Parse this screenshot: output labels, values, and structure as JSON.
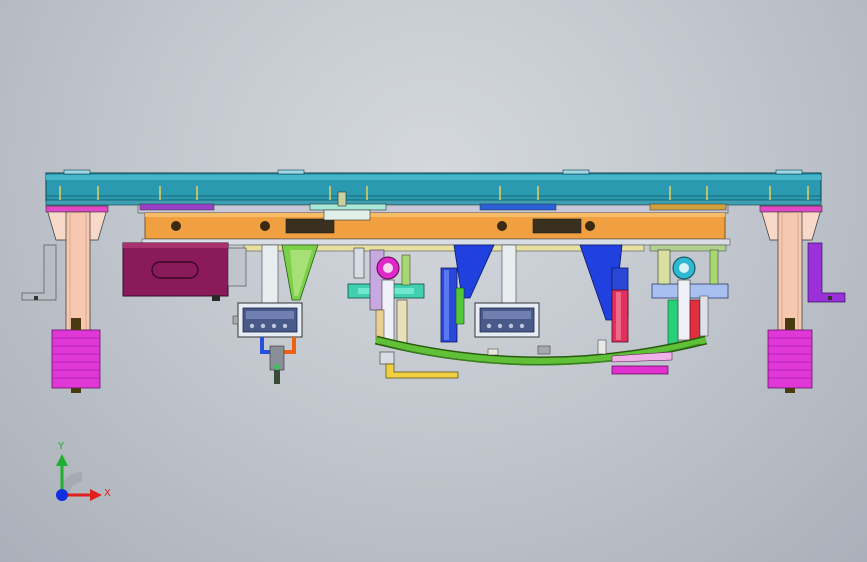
{
  "viewport": {
    "background_top": "#d4d8de",
    "background_bottom": "#aab0b9"
  },
  "triad": {
    "x_label": "X",
    "y_label": "Y",
    "x_color": "#e02020",
    "y_color": "#20b030",
    "z_color": "#1030e0"
  },
  "model": {
    "colors": {
      "top_beam": "#2a9ab0",
      "frame": "#f0a040",
      "leg": "#f6c8b0",
      "foot": "#e030d0",
      "motor": "#8b1a5a",
      "bracket_blue": "#2040e0",
      "bracket_purple": "#9030d0",
      "spring": "#50b830"
    },
    "display_units": [
      {
        "name": "left-readout",
        "digits": 4
      },
      {
        "name": "center-readout",
        "digits": 4
      }
    ]
  }
}
